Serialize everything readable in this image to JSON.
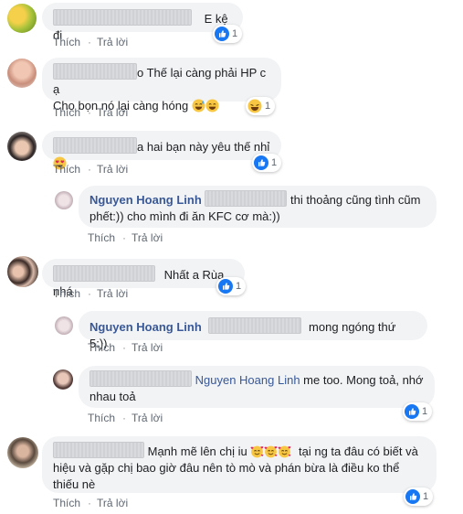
{
  "actions": {
    "like": "Thích",
    "reply": "Trả lời",
    "sep": "·"
  },
  "comments": [
    {
      "text": "E kệ đi",
      "reactions": {
        "type": "like",
        "count": "1"
      }
    },
    {
      "line1": "o Thế lại càng phải HP c ạ",
      "line2": "Cho bọn nó lại càng hóng",
      "emoji": [
        "grinning-sweat",
        "smiling-eyes"
      ],
      "reactions": {
        "type": "haha",
        "count": "1"
      }
    },
    {
      "text": "a hai bạn này yêu thế nhỉ",
      "emoji": [
        "heart-eyes"
      ],
      "reactions": {
        "type": "like",
        "count": "1"
      }
    },
    {
      "name": "Nguyen Hoang Linh",
      "line1": "thi thoảng cũng tình cũm",
      "line2": "phết:)) cho mình đi ăn KFC cơ mà:))"
    },
    {
      "text": "Nhất a Rùa nhá",
      "reactions": {
        "type": "like",
        "count": "1"
      }
    },
    {
      "name": "Nguyen Hoang Linh",
      "text": "mong ngóng thứ 5:))"
    },
    {
      "mention": "Nguyen Hoang Linh",
      "line1": "me too. Mong toả, nhớ",
      "line2": "nhau toả",
      "reactions": {
        "type": "like",
        "count": "1"
      }
    },
    {
      "line1a": "Mạnh mẽ lên chị iu",
      "line1b": "tại ng ta đâu có biết và",
      "line2": "hiệu và gặp chị bao giờ đâu nên tò mò và phán bừa là điều ko thể",
      "line3": "thiếu nè",
      "emoji": [
        "hearts-face",
        "hearts-face",
        "hearts-face"
      ],
      "reactions": {
        "type": "like",
        "count": "1"
      }
    }
  ],
  "colors": {
    "like_blue": "#1877f2",
    "name_blue": "#385898",
    "bubble": "#f2f3f5"
  }
}
